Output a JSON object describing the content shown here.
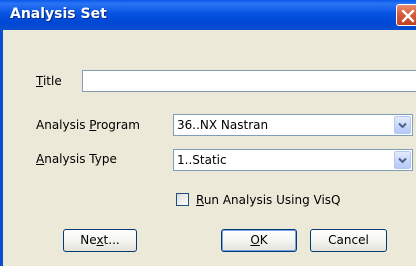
{
  "window": {
    "title": "Analysis Set"
  },
  "fields": {
    "title": {
      "label_mnemonic": "T",
      "label_rest": "itle",
      "value": ""
    },
    "analysis_program": {
      "label_prefix": "Analysis ",
      "label_mnemonic": "P",
      "label_rest": "rogram",
      "selected": "36..NX Nastran"
    },
    "analysis_type": {
      "label_mnemonic": "A",
      "label_rest": "nalysis Type",
      "selected": "1..Static"
    },
    "run_visq": {
      "label_mnemonic": "R",
      "label_rest": "un Analysis Using VisQ",
      "checked": false
    }
  },
  "buttons": {
    "next": {
      "label_prefix": "Ne",
      "label_mnemonic": "x",
      "label_rest": "t..."
    },
    "ok": {
      "label_mnemonic": "O",
      "label_rest": "K"
    },
    "cancel": {
      "label": "Cancel"
    }
  },
  "colors": {
    "titlebar": "#0654e2",
    "dialog_bg": "#ece9d8",
    "field_border": "#7f9db9",
    "button_border": "#003c74",
    "close_button": "#d95c3c"
  },
  "icons": {
    "close": "close-x-icon",
    "dropdown": "chevron-down-icon"
  }
}
